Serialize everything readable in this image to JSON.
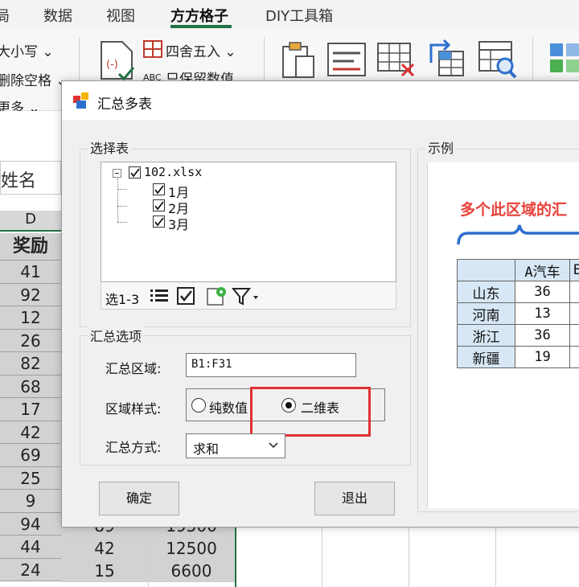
{
  "ribbon": {
    "tabs": [
      {
        "label": "局",
        "active": false
      },
      {
        "label": "数据",
        "active": false
      },
      {
        "label": "视图",
        "active": false
      },
      {
        "label": "方方格子",
        "active": true
      },
      {
        "label": "DIY工具箱",
        "active": false
      }
    ],
    "left_items": [
      "大小写",
      "删除空格",
      "更多"
    ],
    "mid_items": [
      "四舍五入",
      "只保留数值"
    ],
    "abc_label": "ABC"
  },
  "sheet": {
    "name_box": "姓名",
    "column_header": "D",
    "col_d": [
      "奖励",
      "41",
      "92",
      "12",
      "26",
      "82",
      "68",
      "17",
      "42",
      "69",
      "25",
      "9",
      "94",
      "44",
      "24"
    ],
    "bottom_rows": [
      [
        "89",
        "19500"
      ],
      [
        "42",
        "12500"
      ],
      [
        "15",
        "6600"
      ]
    ]
  },
  "dialog": {
    "title": "汇总多表",
    "select_group": "选择表",
    "tree": {
      "root": "102.xlsx",
      "children": [
        "1月",
        "2月",
        "3月"
      ]
    },
    "toolbar_text": "选1-3",
    "options_group": "汇总选项",
    "range_label": "汇总区域:",
    "range_value": "B1:F31",
    "style_label": "区域样式:",
    "radio_plain": "纯数值",
    "radio_2d": "二维表",
    "method_label": "汇总方式:",
    "method_value": "求和",
    "ok_button": "确定",
    "exit_button": "退出",
    "example_group": "示例",
    "example": {
      "title": "多个此区域的汇",
      "table": {
        "col_headers": [
          "A汽车",
          "B"
        ],
        "rows": [
          {
            "name": "山东",
            "value": "36"
          },
          {
            "name": "河南",
            "value": "13"
          },
          {
            "name": "浙江",
            "value": "36"
          },
          {
            "name": "新疆",
            "value": "19"
          }
        ]
      }
    }
  },
  "colors": {
    "accent_green": "#217346",
    "highlight_red": "#e03131",
    "example_title_red": "#e8403a",
    "brace_blue": "#2f6fcf",
    "header_fill": "#d7e7f5"
  }
}
